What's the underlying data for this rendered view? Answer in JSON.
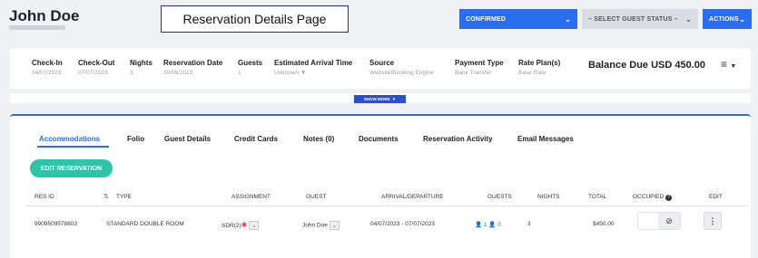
{
  "header": {
    "guest_name": "John Doe",
    "page_label": "Reservation Details Page",
    "status_value": "CONFIRMED",
    "guest_status_placeholder": "– SELECT GUEST STATUS –",
    "actions_label": "ACTIONS"
  },
  "summary": {
    "fields": [
      {
        "label": "Check-In",
        "value": "04/07/2023"
      },
      {
        "label": "Check-Out",
        "value": "07/07/2023"
      },
      {
        "label": "Nights",
        "value": "3"
      },
      {
        "label": "Reservation Date",
        "value": "30/06/2023"
      },
      {
        "label": "Guests",
        "value": "1"
      },
      {
        "label": "Estimated Arrival Time",
        "value": "Unknown"
      },
      {
        "label": "Source",
        "value": "Website/Booking Engine"
      },
      {
        "label": "Payment Type",
        "value": "Bank Transfer"
      },
      {
        "label": "Rate Plan(s)",
        "value": "Base Rate"
      }
    ],
    "balance": "Balance Due USD 450.00",
    "show_more": "SHOW MORE"
  },
  "tabs": [
    {
      "label": "Accommodations",
      "active": true
    },
    {
      "label": "Folio"
    },
    {
      "label": "Guest Details"
    },
    {
      "label": "Credit Cards"
    },
    {
      "label": "Notes (0)"
    },
    {
      "label": "Documents"
    },
    {
      "label": "Reservation Activity"
    },
    {
      "label": "Email Messages"
    }
  ],
  "edit_reservation_label": "EDIT RESERVATION",
  "table": {
    "columns": [
      "RES ID",
      "TYPE",
      "ASSIGNMENT",
      "GUEST",
      "ARRIVAL/DEPARTURE",
      "GUESTS",
      "NIGHTS",
      "TOTAL",
      "OCCUPIED",
      "EDIT"
    ],
    "rows": [
      {
        "res_id": "9909509578803",
        "type": "STANDARD DOUBLE ROOM",
        "assignment": "SDR(2)",
        "guest": "John Doe",
        "dates": "04/07/2023 - 07/07/2023",
        "adults": "1",
        "children": "0",
        "nights": "3",
        "total": "$450.00"
      }
    ]
  },
  "colors": {
    "accent": "#2a6ef0",
    "edit_button": "#2ec4a7",
    "star": "#e23b3b"
  }
}
